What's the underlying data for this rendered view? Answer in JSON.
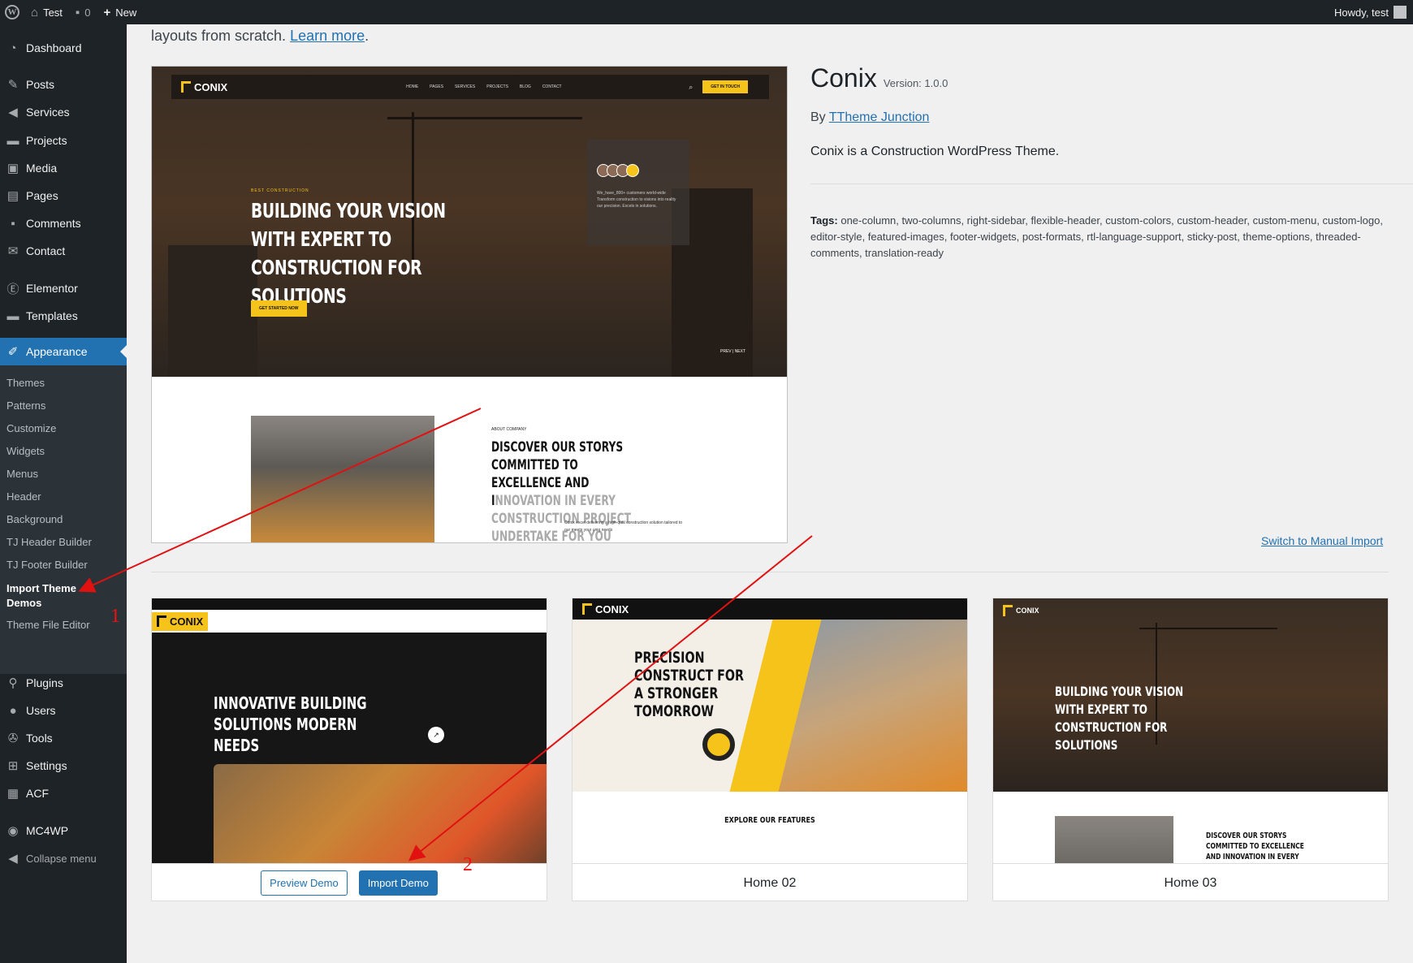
{
  "adminbar": {
    "site_name": "Test",
    "comments_count": "0",
    "new_label": "New",
    "howdy": "Howdy, test"
  },
  "sidebar": {
    "items": [
      {
        "label": "Dashboard",
        "icon": "dashboard-icon"
      },
      {
        "label": "Posts",
        "icon": "pin-icon"
      },
      {
        "label": "Services",
        "icon": "megaphone-icon"
      },
      {
        "label": "Projects",
        "icon": "folder-icon"
      },
      {
        "label": "Media",
        "icon": "media-icon"
      },
      {
        "label": "Pages",
        "icon": "page-icon"
      },
      {
        "label": "Comments",
        "icon": "comment-icon"
      },
      {
        "label": "Contact",
        "icon": "mail-icon"
      },
      {
        "label": "Elementor",
        "icon": "elementor-icon"
      },
      {
        "label": "Templates",
        "icon": "folder-icon"
      },
      {
        "label": "Appearance",
        "icon": "brush-icon"
      },
      {
        "label": "Plugins",
        "icon": "plugin-icon"
      },
      {
        "label": "Users",
        "icon": "user-icon"
      },
      {
        "label": "Tools",
        "icon": "wrench-icon"
      },
      {
        "label": "Settings",
        "icon": "settings-icon"
      },
      {
        "label": "ACF",
        "icon": "grid-icon"
      },
      {
        "label": "MC4WP",
        "icon": "mc4wp-icon"
      },
      {
        "label": "Collapse menu",
        "icon": "collapse-icon"
      }
    ],
    "submenu": [
      "Themes",
      "Patterns",
      "Customize",
      "Widgets",
      "Menus",
      "Header",
      "Background",
      "TJ Header Builder",
      "TJ Footer Builder",
      "Import Theme Demos",
      "Theme File Editor"
    ]
  },
  "main": {
    "intro_text": "layouts from scratch.",
    "intro_link": "Learn more",
    "theme": {
      "name": "Conix",
      "version": "Version: 1.0.0",
      "by": "By",
      "author": "TTheme Junction",
      "description": "Conix is a Construction WordPress Theme.",
      "tags_label": "Tags:",
      "tags": "one-column, two-columns, right-sidebar, flexible-header, custom-colors, custom-header, custom-menu, custom-logo, editor-style, featured-images, footer-widgets, post-formats, rtl-language-support, sticky-post, theme-options, threaded-comments, translation-ready"
    },
    "switch_link": "Switch to Manual Import",
    "screenshot": {
      "logo": "CONIX",
      "nav": [
        "HOME",
        "PAGES",
        "SERVICES",
        "PROJECTS",
        "BLOG",
        "CONTACT"
      ],
      "cta": "GET IN TOUCH",
      "tag": "BEST CONSTRUCTION",
      "title": "BUILDING YOUR VISION WITH EXPERT TO CONSTRUCTION FOR SOLUTIONS",
      "button": "GET STARTED NOW",
      "card_text": "We_have_800+ customers world-wide Transform construction to visions into reality our precision. Excels in solutions.",
      "prev_next": "PREV | NEXT",
      "about_tag": "ABOUT COMPANY",
      "about_title_a": "DISCOVER OUR STORYS COMMITTED TO EXCELLENCE AND I",
      "about_title_b": "NNOVATION IN EVERY CONSTRUCTION PROJECT UNDERTAKE FOR YOU",
      "about_small": "Conix excel delivering a high-qual construction solution tailored to our meets your uniq needs"
    },
    "demos": [
      {
        "title": "INNOVATIVE BUILDING SOLUTIONS MODERN NEEDS",
        "preview_label": "Preview Demo",
        "import_label": "Import Demo"
      },
      {
        "title": "PRECISION CONSTRUCT FOR A STRONGER TOMORROW",
        "features": "EXPLORE OUR FEATURES",
        "name": "Home 02"
      },
      {
        "title": "BUILDING YOUR VISION WITH EXPERT TO CONSTRUCTION FOR SOLUTIONS",
        "about": "DISCOVER OUR STORYS COMMITTED TO EXCELLENCE AND INNOVATION IN EVERY CONSTRUCTION PROJECT",
        "name": "Home 03"
      }
    ]
  },
  "annotations": {
    "num1": "1",
    "num2": "2",
    "color": "#e11111"
  }
}
